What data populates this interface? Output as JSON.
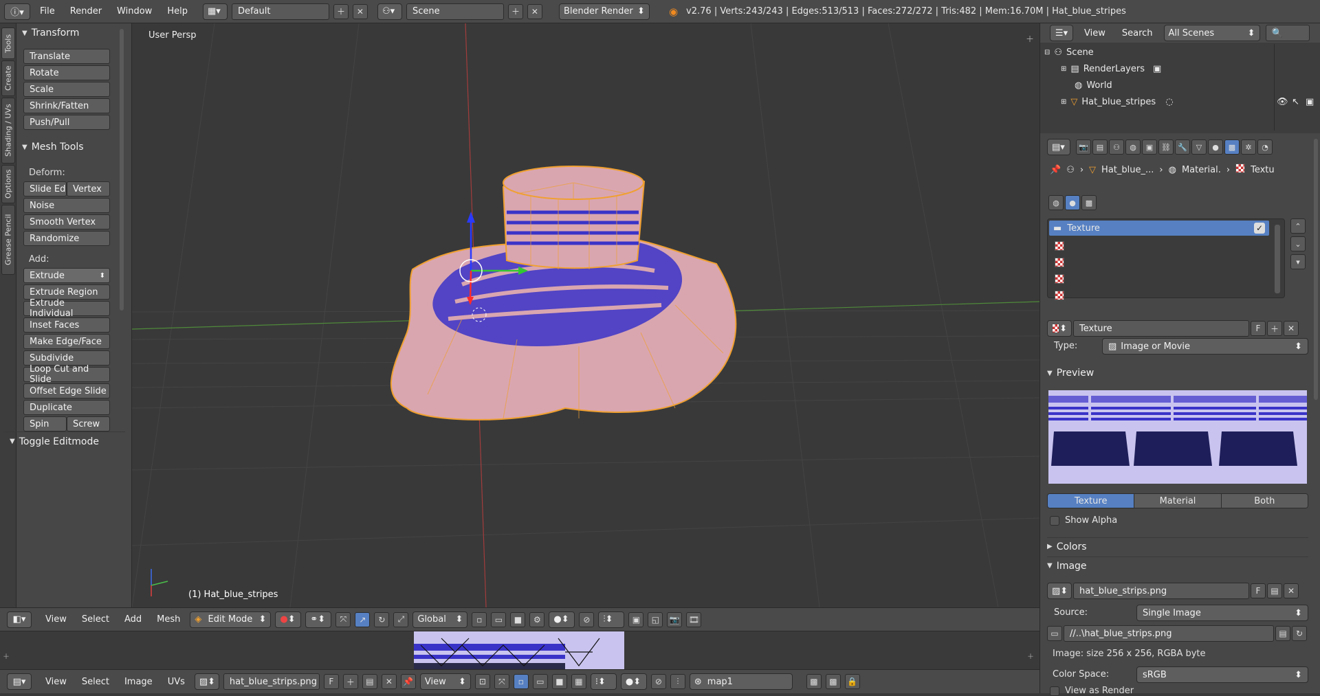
{
  "topbar": {
    "menus": [
      "File",
      "Render",
      "Window",
      "Help"
    ],
    "layout": "Default",
    "scene": "Scene",
    "engine": "Blender Render",
    "stats": "v2.76 | Verts:243/243 | Edges:513/513 | Faces:272/272 | Tris:482 | Mem:16.70M | Hat_blue_stripes"
  },
  "lefttabs": [
    "Tools",
    "Create",
    "Shading / UVs",
    "Options",
    "Grease Pencil"
  ],
  "toolshelf": {
    "transform_title": "Transform",
    "transform_buttons": [
      "Translate",
      "Rotate",
      "Scale",
      "Shrink/Fatten",
      "Push/Pull"
    ],
    "mesh_title": "Mesh Tools",
    "deform_label": "Deform:",
    "slide_edge": "Slide Ed",
    "vertex": "Vertex",
    "deform_buttons": [
      "Noise",
      "Smooth Vertex",
      "Randomize"
    ],
    "add_label": "Add:",
    "extrude": "Extrude",
    "add_buttons": [
      "Extrude Region",
      "Extrude Individual",
      "Inset Faces",
      "Make Edge/Face",
      "Subdivide",
      "Loop Cut and Slide",
      "Offset Edge Slide",
      "Duplicate"
    ],
    "spin": "Spin",
    "screw": "Screw",
    "toggle_title": "Toggle Editmode"
  },
  "viewport": {
    "view_label": "User Persp",
    "object_label": "(1) Hat_blue_stripes"
  },
  "view3d_header": {
    "menus": [
      "View",
      "Select",
      "Add",
      "Mesh"
    ],
    "mode": "Edit Mode",
    "orientation": "Global"
  },
  "uv_header": {
    "menus": [
      "View",
      "Select",
      "Image",
      "UVs"
    ],
    "image": "hat_blue_strips.png",
    "fake": "F",
    "view": "View",
    "uvmap": "map1"
  },
  "outliner": {
    "menus": [
      "View",
      "Search"
    ],
    "filter": "All Scenes",
    "items": [
      "Scene",
      "RenderLayers",
      "World",
      "Hat_blue_stripes"
    ]
  },
  "properties": {
    "breadcrumb": [
      "Hat_blue_...",
      "Material.",
      "Textu"
    ],
    "slot_selected": "Texture",
    "texture_name": "Texture",
    "fake": "F",
    "type_label": "Type:",
    "type_value": "Image or Movie",
    "preview_title": "Preview",
    "preview_tabs": [
      "Texture",
      "Material",
      "Both"
    ],
    "show_alpha": "Show Alpha",
    "colors_title": "Colors",
    "image_title": "Image",
    "image_name": "hat_blue_strips.png",
    "source_label": "Source:",
    "source_value": "Single Image",
    "path": "//..\\hat_blue_strips.png",
    "image_info": "Image: size 256 x 256, RGBA byte",
    "colorspace_label": "Color Space:",
    "colorspace_value": "sRGB",
    "view_as_render": "View as Render"
  },
  "colors": {
    "accent_blue": "#5680c2",
    "mesh_orange": "#f0a030",
    "stripe_blue": "#3a33c8",
    "hat_pink": "#d9a6b0"
  }
}
